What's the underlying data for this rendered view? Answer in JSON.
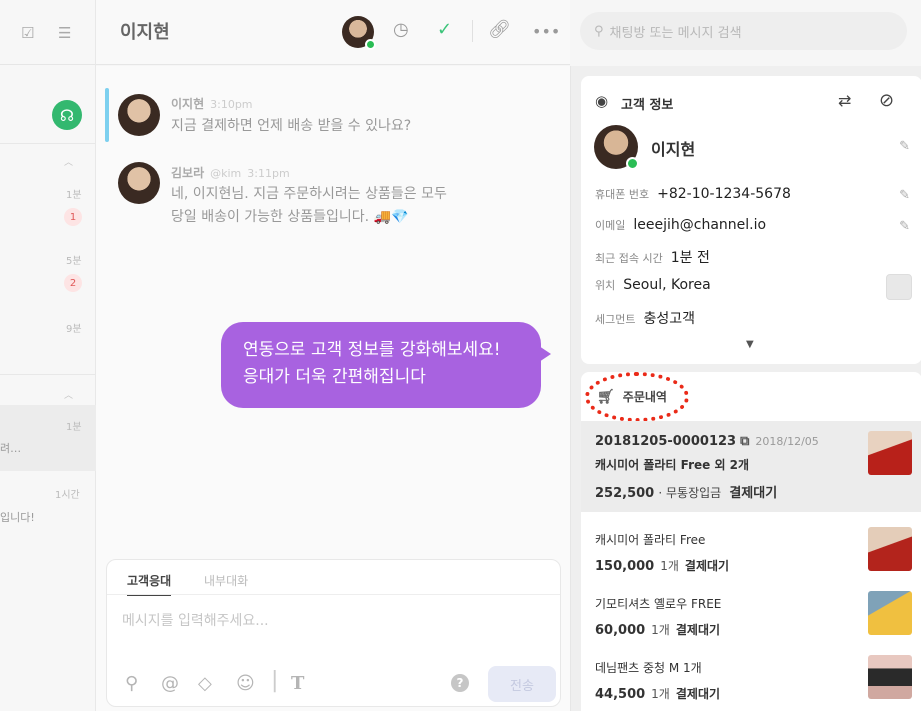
{
  "left": {
    "times": [
      "1분",
      "5분",
      "9분",
      "1분",
      "1시간"
    ],
    "badges": [
      "1",
      "2"
    ],
    "snippets": [
      "려…",
      "입니다!"
    ]
  },
  "header": {
    "title": "이지현"
  },
  "search": {
    "placeholder": "채팅방 또는 메시지 검색"
  },
  "messages": [
    {
      "name": "이지현",
      "handle": "",
      "time": "3:10pm",
      "lines": [
        "지금 결제하면 언제 배송 받을 수 있나요?"
      ]
    },
    {
      "name": "김보라",
      "handle": "@kim",
      "time": "3:11pm",
      "lines": [
        "네, 이지현님. 지금 주문하시려는 상품들은 모두",
        "당일 배송이 가능한 상품들입니다. 🚚💎"
      ]
    }
  ],
  "promo": {
    "line1": "연동으로 고객 정보를 강화해보세요!",
    "line2": "응대가 더욱 간편해집니다"
  },
  "composer": {
    "tab_active": "고객응대",
    "tab_inactive": "내부대화",
    "placeholder": "메시지를 입력해주세요...",
    "send_label": "전송"
  },
  "customer": {
    "section_title": "고객 정보",
    "name": "이지현",
    "fields": [
      {
        "label": "휴대폰 번호",
        "value": "+82-10-1234-5678"
      },
      {
        "label": "이메일",
        "value": "leeejih@channel.io"
      },
      {
        "label": "최근 접속 시간",
        "value": "1분 전"
      },
      {
        "label": "위치",
        "value": "Seoul, Korea"
      },
      {
        "label": "세그먼트",
        "value": "충성고객"
      }
    ]
  },
  "orders": {
    "section_title": "주문내역",
    "main": {
      "id": "20181205-0000123",
      "date": "2018/12/05",
      "name": "캐시미어 폴라티 Free 외 2개",
      "price": "252,500",
      "payment": "· 무통장입금",
      "status": "결제대기"
    },
    "items": [
      {
        "name": "캐시미어 폴라티 Free",
        "price": "150,000",
        "qty": "1개",
        "status": "결제대기"
      },
      {
        "name": "기모티셔츠 옐로우 FREE",
        "price": "60,000",
        "qty": "1개",
        "status": "결제대기"
      },
      {
        "name": "데님팬츠 중청 M 1개",
        "price": "44,500",
        "qty": "1개",
        "status": "결제대기"
      }
    ]
  },
  "colors": {
    "promo_bubble": "#a862e0",
    "online_dot": "#2bbd55",
    "highlight_scribble": "#ea2a18",
    "badge_text": "#e05858",
    "message_accent": "#7dd0ef"
  }
}
